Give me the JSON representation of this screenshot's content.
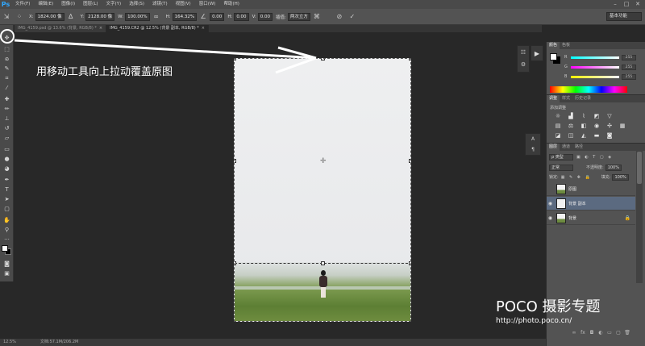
{
  "app": {
    "logo": "Ps"
  },
  "menu": {
    "items": [
      "文件(F)",
      "编辑(E)",
      "图像(I)",
      "图层(L)",
      "文字(Y)",
      "选择(S)",
      "滤镜(T)",
      "视图(V)",
      "窗口(W)",
      "帮助(H)"
    ]
  },
  "options": {
    "x_label": "X:",
    "x_value": "1824.00 像",
    "y_label": "Y:",
    "y_value": "2128.00 像",
    "w_label": "W:",
    "w_value": "100.00%",
    "h_label": "H:",
    "h_value": "164.32%",
    "angle_value": "0.00",
    "hskew_label": "H:",
    "hskew_value": "0.00",
    "vskew_label": "V:",
    "vskew_value": "0.00",
    "interp_label": "插值:",
    "interp_value": "两次立方",
    "workspace": "基本功能"
  },
  "tabs": [
    {
      "label": "IMG_4159.psd @ 13.6% (背景, RGB/8) *",
      "active": false
    },
    {
      "label": "IMG_4159.CR2 @ 12.5% (背景 副本, RGB/8) *",
      "active": true
    }
  ],
  "annotation": {
    "text": "用移动工具向上拉动覆盖原图"
  },
  "color_panel": {
    "tabs": [
      "颜色",
      "色板"
    ],
    "r_label": "R",
    "g_label": "G",
    "b_label": "B",
    "r_value": "255",
    "g_value": "255",
    "b_value": "255"
  },
  "adjust_panel": {
    "tabs": [
      "调整",
      "样式",
      "历史记录"
    ],
    "title": "添加调整"
  },
  "layers_panel": {
    "tabs": [
      "图层",
      "通道",
      "路径"
    ],
    "kind_filter": "ρ 类型",
    "blend_mode": "正常",
    "opacity_label": "不透明度:",
    "opacity_value": "100%",
    "lock_label": "锁定:",
    "fill_label": "填充:",
    "fill_value": "100%",
    "layers": [
      {
        "name": "原图",
        "visible": false,
        "selected": false
      },
      {
        "name": "背景 副本",
        "visible": true,
        "selected": true
      },
      {
        "name": "背景",
        "visible": true,
        "selected": false,
        "locked": true
      }
    ]
  },
  "status": {
    "zoom": "12.5%",
    "doc": "文档:57.1M/206.2M"
  },
  "watermark": {
    "brand": "POCO 摄影专题",
    "url": "http://photo.poco.cn/"
  },
  "colors": {
    "accent": "#31a8ff",
    "selected_layer": "#5b6a80",
    "annotation": "#ffffff"
  }
}
